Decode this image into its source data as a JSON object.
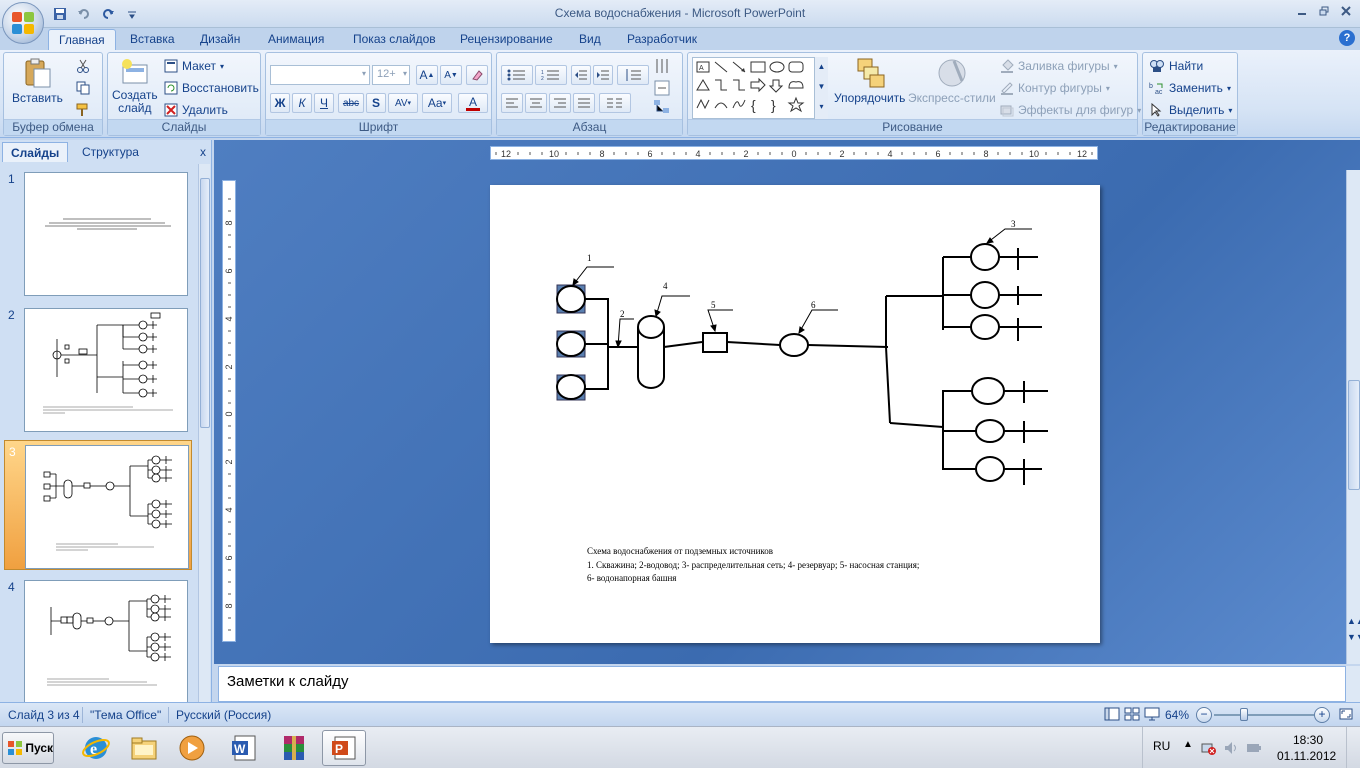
{
  "window": {
    "title": "Схема водоснабжения - Microsoft PowerPoint",
    "controls": [
      "minimize-icon",
      "restore-icon",
      "close-icon"
    ]
  },
  "qat": {
    "icons": [
      "save-icon",
      "undo-icon",
      "redo-icon",
      "customize-icon"
    ]
  },
  "tabs": [
    {
      "label": "Главная",
      "active": true
    },
    {
      "label": "Вставка"
    },
    {
      "label": "Дизайн"
    },
    {
      "label": "Анимация"
    },
    {
      "label": "Показ слайдов"
    },
    {
      "label": "Рецензирование"
    },
    {
      "label": "Вид"
    },
    {
      "label": "Разработчик"
    }
  ],
  "ribbon": {
    "clipboard": {
      "label": "Буфер обмена",
      "paste": "Вставить"
    },
    "slides": {
      "label": "Слайды",
      "new_slide_1": "Создать",
      "new_slide_2": "слайд",
      "layout": "Макет",
      "reset": "Восстановить",
      "delete": "Удалить"
    },
    "font": {
      "label": "Шрифт",
      "size": "12+",
      "bold": "Ж",
      "italic": "К",
      "underline": "Ч",
      "strike": "abc",
      "shadow": "S",
      "spacing": "AV",
      "case": "Aa",
      "color": "A",
      "grow": "A",
      "shrink": "A"
    },
    "paragraph": {
      "label": "Абзац"
    },
    "drawing": {
      "label": "Рисование",
      "arrange": "Упорядочить",
      "quick_styles": "Экспресс-стили",
      "fill": "Заливка фигуры",
      "outline": "Контур фигуры",
      "effects": "Эффекты для фигур"
    },
    "editing": {
      "label": "Редактирование",
      "find": "Найти",
      "replace": "Заменить",
      "select": "Выделить"
    }
  },
  "left_pane": {
    "tabs": [
      {
        "label": "Слайды",
        "active": true
      },
      {
        "label": "Структура"
      }
    ],
    "close": "x",
    "thumbnails": [
      {
        "num": "1"
      },
      {
        "num": "2"
      },
      {
        "num": "3",
        "selected": true
      },
      {
        "num": "4"
      }
    ]
  },
  "ruler": {
    "h_labels": [
      "12",
      "10",
      "8",
      "6",
      "4",
      "2",
      "0",
      "2",
      "4",
      "6",
      "8",
      "10",
      "12"
    ],
    "v_labels": [
      "8",
      "6",
      "4",
      "2",
      "0",
      "2",
      "4",
      "6",
      "8"
    ]
  },
  "slide": {
    "labels": [
      "1",
      "2",
      "3",
      "4",
      "5",
      "6"
    ],
    "caption_title": "Схема водоснабжения  от подземных  источников",
    "caption_line1": "1.   Скважина; 2-водовод; 3- распределительная  сеть; 4- резервуар; 5- насосная  станция;",
    "caption_line2": "6- водонапорная   башня"
  },
  "notes": {
    "text": "Заметки к слайду"
  },
  "status": {
    "slide_counter": "Слайд 3 из 4",
    "theme": "\"Тема Office\"",
    "language": "Русский (Россия)",
    "zoom": "64%"
  },
  "taskbar": {
    "start": "Пуск",
    "apps": [
      "ie-icon",
      "explorer-icon",
      "media-player-icon",
      "word-icon",
      "winrar-icon",
      "powerpoint-icon"
    ],
    "lang": "RU",
    "time": "18:30",
    "date": "01.11.2012"
  },
  "colors": {
    "accent": "#15428b",
    "ribbon": "#dce8f7",
    "editor_bg": "#4f7ec1",
    "selected_thumb": "#f0a040"
  }
}
